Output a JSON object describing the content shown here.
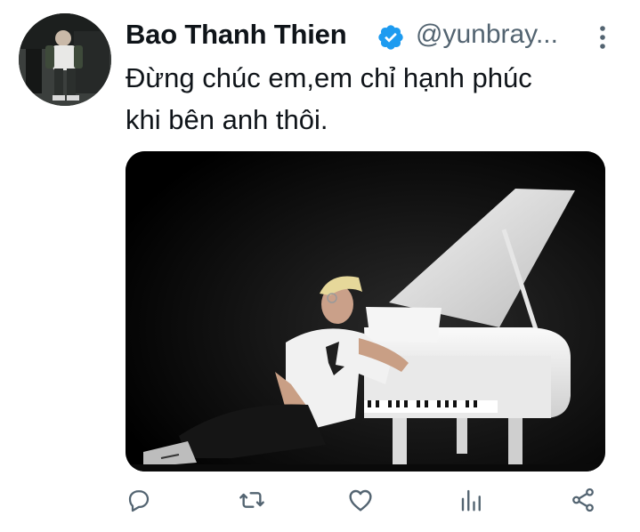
{
  "tweet": {
    "author": {
      "display_name": "Bao Thanh Thien",
      "handle": "@yunbray...",
      "verified": true
    },
    "text_lines": [
      "Đừng chúc em,em chỉ hạnh phúc",
      "khi bên anh thôi."
    ],
    "actions": [
      {
        "name": "reply",
        "icon": "reply-icon"
      },
      {
        "name": "retweet",
        "icon": "retweet-icon"
      },
      {
        "name": "like",
        "icon": "heart-icon"
      },
      {
        "name": "analytics",
        "icon": "analytics-icon"
      },
      {
        "name": "share",
        "icon": "share-icon"
      }
    ]
  },
  "colors": {
    "verified_blue": "#1d9bf0",
    "secondary_text": "#536471",
    "icon_gray": "#536471"
  }
}
